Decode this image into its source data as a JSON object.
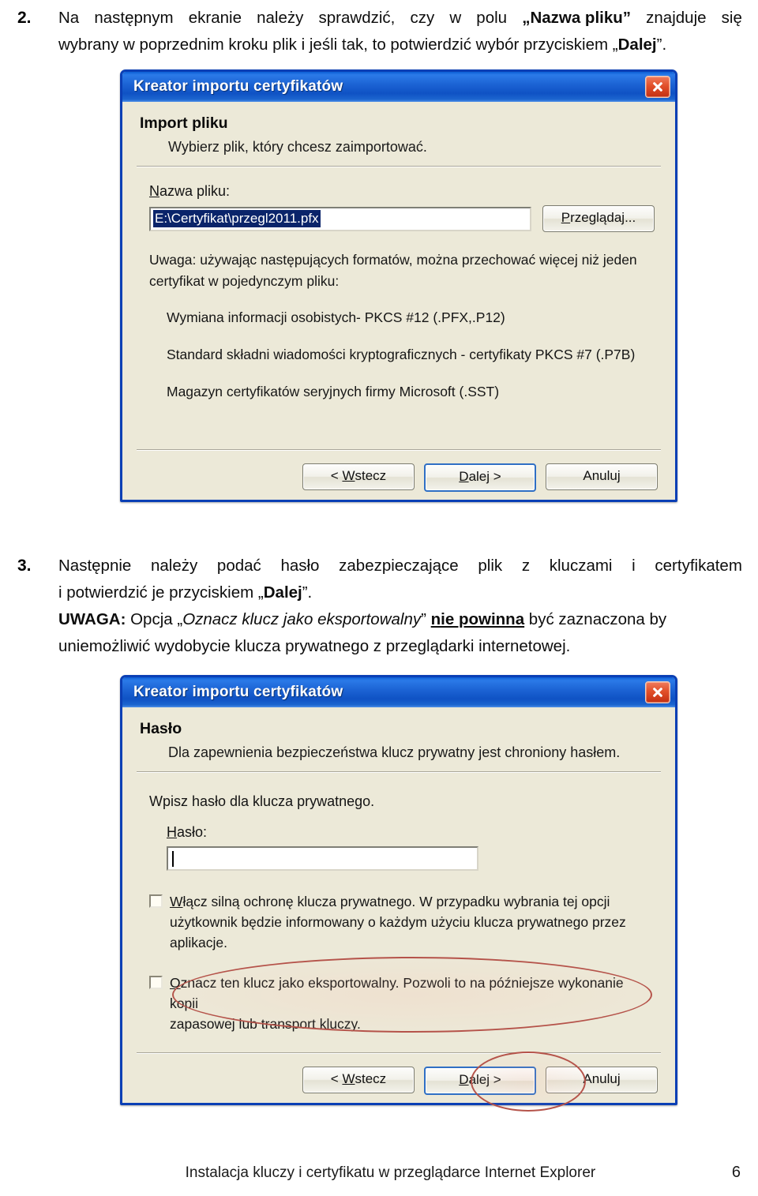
{
  "document": {
    "paragraph_2": {
      "number": "2.",
      "line1_a": "Na",
      "line1_b": "następnym",
      "line1_c": "ekranie",
      "line1_d": "należy",
      "line1_e": "sprawdzić,",
      "line1_f": "czy",
      "line1_g": "w",
      "line1_h": "polu",
      "line1_i": "„Nazwa pliku”",
      "line1_j": "znajduje",
      "line1_k": "się",
      "line2_pre": "wybrany w poprzednim kroku plik i jeśli tak, to potwierdzić wybór przyciskiem „",
      "line2_bold": "Dalej",
      "line2_post": "”."
    },
    "paragraph_3": {
      "number": "3.",
      "line1_a": "Następnie",
      "line1_b": "należy",
      "line1_c": "podać",
      "line1_d": "hasło",
      "line1_e": "zabezpieczające",
      "line1_f": "plik",
      "line1_g": "z",
      "line1_h": "kluczami",
      "line1_i": "i",
      "line1_j": "certyfikatem",
      "line2_pre": "i potwierdzić je przyciskiem „",
      "line2_bold": "Dalej",
      "line2_post": "”.",
      "line3_label": "UWAGA:",
      "line3_a": " Opcja „",
      "line3_italic": "Oznacz klucz jako eksportowalny",
      "line3_b": "” ",
      "line3_underline": "nie powinna",
      "line3_c": " być zaznaczona by",
      "line4": "uniemożliwić wydobycie klucza prywatnego z przeglądarki internetowej."
    },
    "footer": {
      "title": "Instalacja kluczy i certyfikatu w przeglądarce Internet Explorer",
      "page_number": "6"
    }
  },
  "dialog_file_import": {
    "titlebar": {
      "title": "Kreator importu certyfikatów",
      "close_icon": "close-icon"
    },
    "header": {
      "title": "Import pliku",
      "subtitle": "Wybierz plik, który chcesz zaimportować."
    },
    "file_field": {
      "label_accel": "N",
      "label_rest": "azwa pliku:",
      "value": "E:\\Certyfikat\\przegl2011.pfx",
      "browse_button_accel": "P",
      "browse_button_rest": "rzeglądaj..."
    },
    "notes": {
      "intro_line1": "Uwaga: używając następujących formatów, można przechować więcej niż jeden",
      "intro_line2": "certyfikat w pojedynczym pliku:",
      "items": [
        "Wymiana informacji osobistych- PKCS #12 (.PFX,.P12)",
        "Standard składni wiadomości kryptograficznych - certyfikaty PKCS #7 (.P7B)",
        "Magazyn certyfikatów seryjnych firmy Microsoft (.SST)"
      ]
    },
    "buttons": {
      "back_pre": "< ",
      "back_accel": "W",
      "back_rest": "stecz",
      "next_accel": "D",
      "next_rest": "alej >",
      "cancel": "Anuluj"
    }
  },
  "dialog_password": {
    "titlebar": {
      "title": "Kreator importu certyfikatów",
      "close_icon": "close-icon"
    },
    "header": {
      "title": "Hasło",
      "subtitle": "Dla zapewnienia bezpieczeństwa klucz prywatny jest chroniony hasłem."
    },
    "instruction": "Wpisz hasło dla klucza prywatnego.",
    "password_field": {
      "label_accel": "H",
      "label_rest": "asło:",
      "value": ""
    },
    "checkbox_strong": {
      "checked": false,
      "accel": "W",
      "line1_rest": "łącz silną ochronę klucza prywatnego. W przypadku wybrania tej opcji",
      "line2": "użytkownik będzie informowany o każdym użyciu klucza prywatnego przez",
      "line3": "aplikacje."
    },
    "checkbox_exportable": {
      "checked": false,
      "accel": "O",
      "line1_rest": "znacz ten klucz jako eksportowalny. Pozwoli to na późniejsze wykonanie kopii",
      "line2": "zapasowej lub transport kluczy."
    },
    "buttons": {
      "back_pre": "< ",
      "back_accel": "W",
      "back_rest": "stecz",
      "next_accel": "D",
      "next_rest": "alej >",
      "cancel": "Anuluj"
    }
  },
  "annotations": {
    "ellipse_exportable": "red-ellipse-highlight",
    "ellipse_next_button": "red-ellipse-highlight"
  },
  "colors": {
    "titlebar_blue": "#1c63d4",
    "dialog_border": "#0a3fb5",
    "dialog_face": "#ece9d8",
    "close_red": "#c32f12",
    "selection_blue": "#0a246a",
    "annotation_red": "#b5534a"
  }
}
